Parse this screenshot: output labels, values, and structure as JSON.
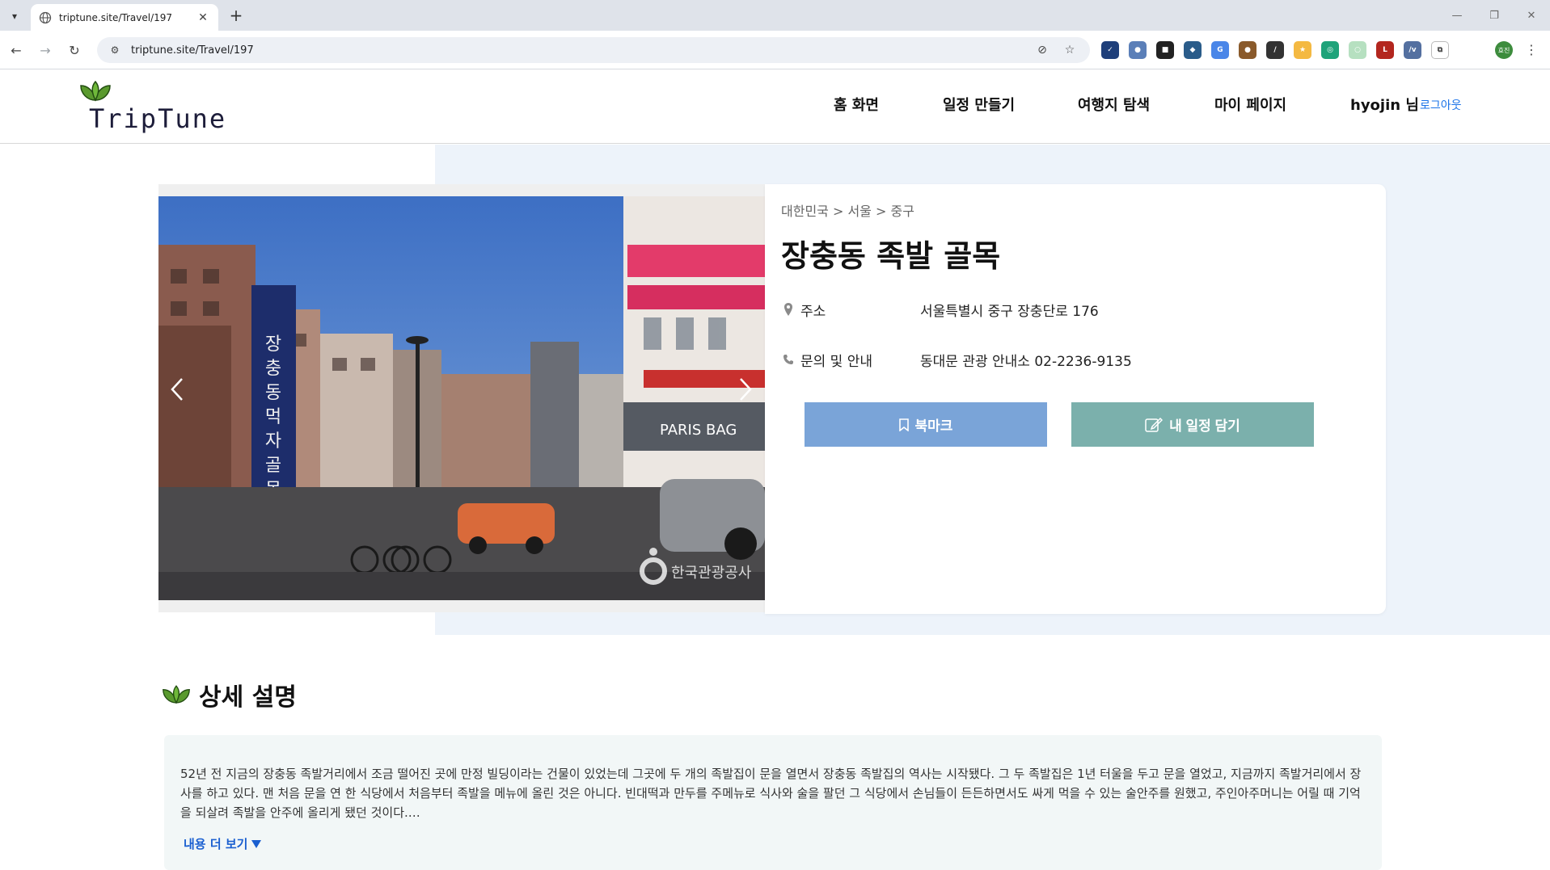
{
  "browser": {
    "tab_title": "triptune.site/Travel/197",
    "url": "triptune.site/Travel/197",
    "profile_label": "효진"
  },
  "site": {
    "logo_text": "TripTune",
    "nav": [
      "홈 화면",
      "일정 만들기",
      "여행지 탐색",
      "마이 페이지"
    ],
    "user_name": "hyojin 님",
    "logout_label": "로그아웃"
  },
  "place": {
    "breadcrumb": "대한민국 > 서울 > 중구",
    "title": "장충동 족발 골목",
    "address_label": "주소",
    "address": "서울특별시 중구 장충단로 176",
    "contact_label": "문의 및 안내",
    "contact": "동대문 관광 안내소 02-2236-9135",
    "bookmark_label": "북마크",
    "add_schedule_label": "내 일정 담기",
    "photo_watermark": "한국관광공사"
  },
  "detail": {
    "heading": "상세 설명",
    "text": "52년 전 지금의 장충동 족발거리에서 조금 떨어진 곳에 만정 빌딩이라는 건물이 있었는데 그곳에 두 개의 족발집이 문을 열면서 장충동 족발집의 역사는 시작됐다. 그 두 족발집은 1년 터울을 두고 문을 열었고, 지금까지 족발거리에서 장사를 하고 있다. 맨 처음 문을 연 한 식당에서 처음부터 족발을 메뉴에 올린 것은 아니다. 빈대떡과 만두를 주메뉴로 식사와 술을 팔던 그 식당에서 손님들이 든든하면서도 싸게 먹을 수 있는 술안주를 원했고, 주인아주머니는 어릴 때 기억을 되살려 족발을 안주에 올리게 됐던 것이다.…",
    "more_label": "내용 더 보기"
  },
  "colors": {
    "bookmark_button": "#7aa4d8",
    "schedule_button": "#7bb0ac",
    "link": "#1a73e8",
    "section_bg": "#edf3fa"
  }
}
